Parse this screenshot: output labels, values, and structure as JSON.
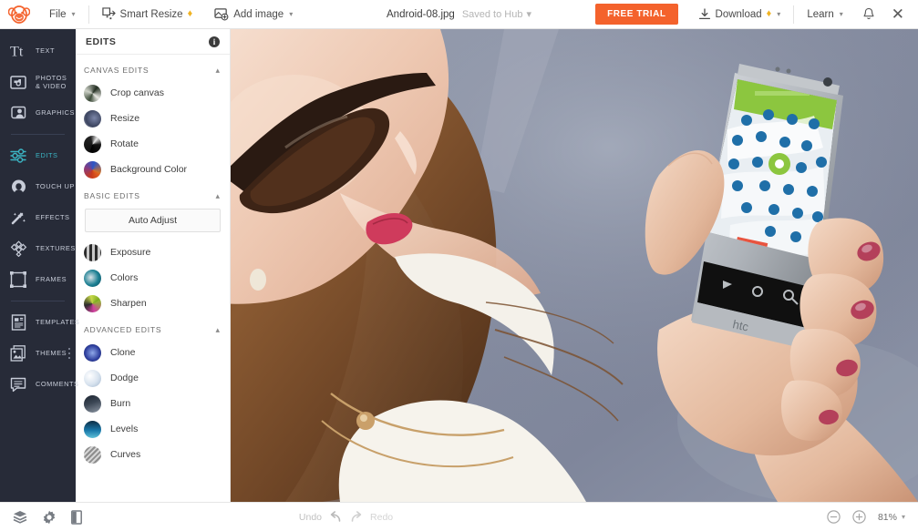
{
  "topbar": {
    "logo": "picmonkey-monkey-logo",
    "file_menu": "File",
    "smart_resize": "Smart Resize",
    "add_image": "Add image",
    "filename": "Android-08.jpg",
    "saved_status": "Saved to Hub",
    "free_trial": "FREE TRIAL",
    "download": "Download",
    "learn": "Learn",
    "accent_color": "#f4622c"
  },
  "rail": {
    "items": [
      {
        "label": "TEXT",
        "icon": "text-tt-icon",
        "active": false
      },
      {
        "label": "PHOTOS\n& VIDEO",
        "icon": "photos-video-icon",
        "active": false
      },
      {
        "label": "GRAPHICS",
        "icon": "graphics-icon",
        "active": false
      },
      {
        "label": "EDITS",
        "icon": "edits-sliders-icon",
        "active": true
      },
      {
        "label": "TOUCH UP",
        "icon": "touch-up-face-icon",
        "active": false
      },
      {
        "label": "EFFECTS",
        "icon": "effects-wand-icon",
        "active": false
      },
      {
        "label": "TEXTURES",
        "icon": "textures-icon",
        "active": false
      },
      {
        "label": "FRAMES",
        "icon": "frames-icon",
        "active": false
      },
      {
        "label": "TEMPLATES",
        "icon": "templates-icon",
        "active": false
      },
      {
        "label": "THEMES",
        "icon": "themes-icon",
        "active": false
      },
      {
        "label": "COMMENTS",
        "icon": "comments-icon",
        "active": false
      }
    ],
    "active_color": "#3bb5c4",
    "background": "#272b38"
  },
  "panel": {
    "title": "EDITS",
    "info_icon": "info-icon",
    "groups": [
      {
        "title": "CANVAS EDITS",
        "collapsed": false,
        "items": [
          {
            "label": "Crop canvas",
            "thumb": "crop-canvas-thumb"
          },
          {
            "label": "Resize",
            "thumb": "resize-thumb"
          },
          {
            "label": "Rotate",
            "thumb": "rotate-thumb"
          },
          {
            "label": "Background Color",
            "thumb": "background-color-thumb"
          }
        ]
      },
      {
        "title": "BASIC EDITS",
        "collapsed": false,
        "auto_adjust": "Auto Adjust",
        "items": [
          {
            "label": "Exposure",
            "thumb": "exposure-thumb"
          },
          {
            "label": "Colors",
            "thumb": "colors-thumb"
          },
          {
            "label": "Sharpen",
            "thumb": "sharpen-thumb"
          }
        ]
      },
      {
        "title": "ADVANCED EDITS",
        "collapsed": false,
        "items": [
          {
            "label": "Clone",
            "thumb": "clone-thumb"
          },
          {
            "label": "Dodge",
            "thumb": "dodge-thumb"
          },
          {
            "label": "Burn",
            "thumb": "burn-thumb"
          },
          {
            "label": "Levels",
            "thumb": "levels-thumb"
          },
          {
            "label": "Curves",
            "thumb": "curves-thumb"
          }
        ]
      }
    ]
  },
  "canvas": {
    "description": "Photo of a woman in sunglasses with long brown hair holding an HTC smartphone showing a blue map with pins"
  },
  "bottombar": {
    "layers_icon": "layers-icon",
    "settings_icon": "gear-icon",
    "compare_icon": "compare-split-icon",
    "undo": "Undo",
    "redo": "Redo",
    "zoom_out_icon": "zoom-out-icon",
    "zoom_in_icon": "zoom-in-icon",
    "zoom_level": "81%"
  }
}
